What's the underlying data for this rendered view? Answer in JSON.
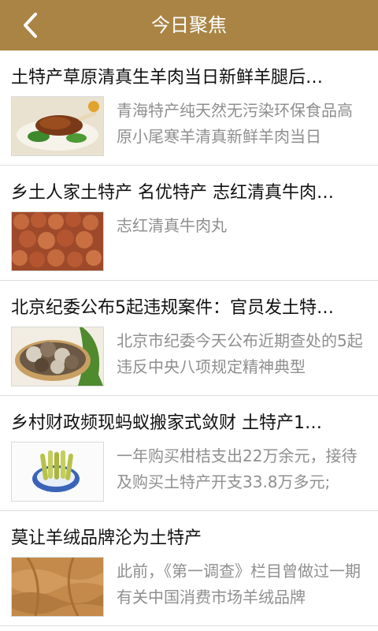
{
  "header": {
    "title": "今日聚焦",
    "back_icon": "chevron-left-icon",
    "background_color": "#a98444"
  },
  "articles": [
    {
      "title": "土特产草原清真生羊肉当日新鲜羊腿后…",
      "summary": "青海特产纯天然无污染环保食品高原小尾寒羊清真新鲜羊肉当日",
      "thumbnail": "roast-lamb-leg-image"
    },
    {
      "title": "乡土人家土特产 名优特产 志红清真牛肉…",
      "summary": "志红清真牛肉丸",
      "thumbnail": "beef-meatballs-image"
    },
    {
      "title": "北京纪委公布5起违规案件：官员发土特…",
      "summary": "北京市纪委今天公布近期查处的5起违反中央八项规定精神典型",
      "thumbnail": "shiitake-mushrooms-image"
    },
    {
      "title": "乡村财政频现蚂蚁搬家式敛财 土特产1…",
      "summary": "一年购买柑桔支出22万余元，接待及购买土特产开支33.8万多元;",
      "thumbnail": "bamboo-shoots-plate-image"
    },
    {
      "title": "莫让羊绒品牌沦为土特产",
      "summary": "此前，《第一调查》栏目曾做过一期有关中国消费市场羊绒品牌",
      "thumbnail": "cashmere-fabric-image"
    }
  ]
}
